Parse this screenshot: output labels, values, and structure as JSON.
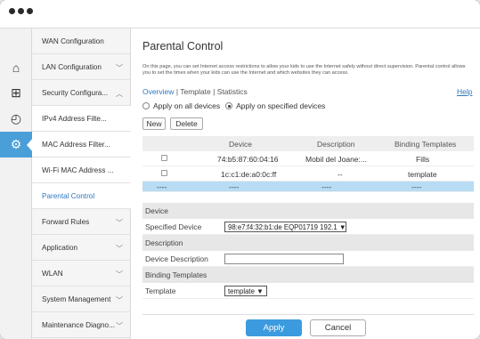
{
  "sidebar": {
    "items": [
      {
        "label": "WAN Configuration",
        "chevron": ""
      },
      {
        "label": "LAN Configuration",
        "chevron": "﹀"
      },
      {
        "label": "Security Configura...",
        "chevron": "︿"
      },
      {
        "label": "IPv4 Address Filte...",
        "chevron": ""
      },
      {
        "label": "MAC Address Filter...",
        "chevron": ""
      },
      {
        "label": "Wi-Fi MAC Address ...",
        "chevron": ""
      },
      {
        "label": "Parental Control",
        "chevron": ""
      },
      {
        "label": "Forward Rules",
        "chevron": "﹀"
      },
      {
        "label": "Application",
        "chevron": "﹀"
      },
      {
        "label": "WLAN",
        "chevron": "﹀"
      },
      {
        "label": "System Management",
        "chevron": "﹀"
      },
      {
        "label": "Maintenance Diagno...",
        "chevron": "﹀"
      }
    ]
  },
  "icons": {
    "home": "⌂",
    "add": "⊞",
    "gauge": "◴",
    "gear": "⚙"
  },
  "main": {
    "title": "Parental Control",
    "intro": "On this page, you can set Internet access restrictions to allow your kids to use the Internet safely without direct supervision. Parental control allows you to set the times when your kids can use the Internet and which websites they can access.",
    "tabs": {
      "overview": "Overview",
      "sep1": "|",
      "template": "Template",
      "sep2": "|",
      "statistics": "Statistics"
    },
    "help": "Help",
    "radio_all": "Apply on all devices",
    "radio_specified": "Apply on specified devices",
    "new_button": "New",
    "delete_button": "Delete",
    "table": {
      "headers": {
        "device": "Device",
        "description": "Description",
        "binding": "Binding Templates"
      },
      "rows": [
        {
          "device": "74:b5:87:60:04:16",
          "description": "Mobil del Joane:...",
          "binding": "Fills"
        },
        {
          "device": "1c:c1:de:a0:0c:ff",
          "description": "--",
          "binding": "template"
        },
        {
          "check": "----",
          "device": "----",
          "description": "----",
          "binding": "----"
        }
      ]
    },
    "form": {
      "device_section": "Device",
      "specified_device_label": "Specified Device",
      "specified_device_value": "98:e7:f4:32:b1:de  EQP01719  192.1 ▼",
      "description_section": "Description",
      "device_description_label": "Device Description",
      "device_description_value": "",
      "binding_section": "Binding Templates",
      "template_label": "Template",
      "template_value": "template ▼"
    },
    "apply": "Apply",
    "cancel": "Cancel"
  },
  "colors": {
    "accent": "#3c9adf",
    "selected_row": "#b8dcf4",
    "link": "#2e77c0"
  }
}
